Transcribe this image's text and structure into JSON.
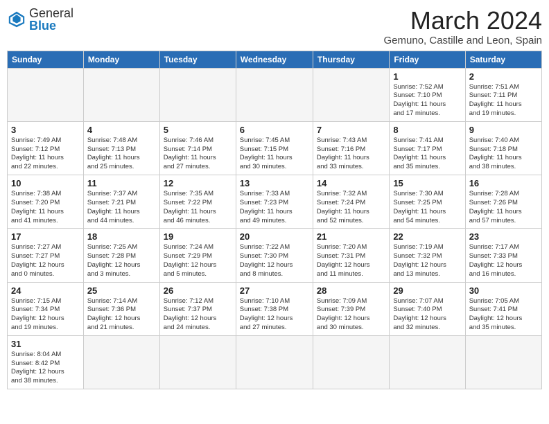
{
  "header": {
    "logo_general": "General",
    "logo_blue": "Blue",
    "month_title": "March 2024",
    "subtitle": "Gemuno, Castille and Leon, Spain"
  },
  "days_of_week": [
    "Sunday",
    "Monday",
    "Tuesday",
    "Wednesday",
    "Thursday",
    "Friday",
    "Saturday"
  ],
  "weeks": [
    [
      {
        "day": null,
        "info": null
      },
      {
        "day": null,
        "info": null
      },
      {
        "day": null,
        "info": null
      },
      {
        "day": null,
        "info": null
      },
      {
        "day": null,
        "info": null
      },
      {
        "day": "1",
        "info": "Sunrise: 7:52 AM\nSunset: 7:10 PM\nDaylight: 11 hours\nand 17 minutes."
      },
      {
        "day": "2",
        "info": "Sunrise: 7:51 AM\nSunset: 7:11 PM\nDaylight: 11 hours\nand 19 minutes."
      }
    ],
    [
      {
        "day": "3",
        "info": "Sunrise: 7:49 AM\nSunset: 7:12 PM\nDaylight: 11 hours\nand 22 minutes."
      },
      {
        "day": "4",
        "info": "Sunrise: 7:48 AM\nSunset: 7:13 PM\nDaylight: 11 hours\nand 25 minutes."
      },
      {
        "day": "5",
        "info": "Sunrise: 7:46 AM\nSunset: 7:14 PM\nDaylight: 11 hours\nand 27 minutes."
      },
      {
        "day": "6",
        "info": "Sunrise: 7:45 AM\nSunset: 7:15 PM\nDaylight: 11 hours\nand 30 minutes."
      },
      {
        "day": "7",
        "info": "Sunrise: 7:43 AM\nSunset: 7:16 PM\nDaylight: 11 hours\nand 33 minutes."
      },
      {
        "day": "8",
        "info": "Sunrise: 7:41 AM\nSunset: 7:17 PM\nDaylight: 11 hours\nand 35 minutes."
      },
      {
        "day": "9",
        "info": "Sunrise: 7:40 AM\nSunset: 7:18 PM\nDaylight: 11 hours\nand 38 minutes."
      }
    ],
    [
      {
        "day": "10",
        "info": "Sunrise: 7:38 AM\nSunset: 7:20 PM\nDaylight: 11 hours\nand 41 minutes."
      },
      {
        "day": "11",
        "info": "Sunrise: 7:37 AM\nSunset: 7:21 PM\nDaylight: 11 hours\nand 44 minutes."
      },
      {
        "day": "12",
        "info": "Sunrise: 7:35 AM\nSunset: 7:22 PM\nDaylight: 11 hours\nand 46 minutes."
      },
      {
        "day": "13",
        "info": "Sunrise: 7:33 AM\nSunset: 7:23 PM\nDaylight: 11 hours\nand 49 minutes."
      },
      {
        "day": "14",
        "info": "Sunrise: 7:32 AM\nSunset: 7:24 PM\nDaylight: 11 hours\nand 52 minutes."
      },
      {
        "day": "15",
        "info": "Sunrise: 7:30 AM\nSunset: 7:25 PM\nDaylight: 11 hours\nand 54 minutes."
      },
      {
        "day": "16",
        "info": "Sunrise: 7:28 AM\nSunset: 7:26 PM\nDaylight: 11 hours\nand 57 minutes."
      }
    ],
    [
      {
        "day": "17",
        "info": "Sunrise: 7:27 AM\nSunset: 7:27 PM\nDaylight: 12 hours\nand 0 minutes."
      },
      {
        "day": "18",
        "info": "Sunrise: 7:25 AM\nSunset: 7:28 PM\nDaylight: 12 hours\nand 3 minutes."
      },
      {
        "day": "19",
        "info": "Sunrise: 7:24 AM\nSunset: 7:29 PM\nDaylight: 12 hours\nand 5 minutes."
      },
      {
        "day": "20",
        "info": "Sunrise: 7:22 AM\nSunset: 7:30 PM\nDaylight: 12 hours\nand 8 minutes."
      },
      {
        "day": "21",
        "info": "Sunrise: 7:20 AM\nSunset: 7:31 PM\nDaylight: 12 hours\nand 11 minutes."
      },
      {
        "day": "22",
        "info": "Sunrise: 7:19 AM\nSunset: 7:32 PM\nDaylight: 12 hours\nand 13 minutes."
      },
      {
        "day": "23",
        "info": "Sunrise: 7:17 AM\nSunset: 7:33 PM\nDaylight: 12 hours\nand 16 minutes."
      }
    ],
    [
      {
        "day": "24",
        "info": "Sunrise: 7:15 AM\nSunset: 7:34 PM\nDaylight: 12 hours\nand 19 minutes."
      },
      {
        "day": "25",
        "info": "Sunrise: 7:14 AM\nSunset: 7:36 PM\nDaylight: 12 hours\nand 21 minutes."
      },
      {
        "day": "26",
        "info": "Sunrise: 7:12 AM\nSunset: 7:37 PM\nDaylight: 12 hours\nand 24 minutes."
      },
      {
        "day": "27",
        "info": "Sunrise: 7:10 AM\nSunset: 7:38 PM\nDaylight: 12 hours\nand 27 minutes."
      },
      {
        "day": "28",
        "info": "Sunrise: 7:09 AM\nSunset: 7:39 PM\nDaylight: 12 hours\nand 30 minutes."
      },
      {
        "day": "29",
        "info": "Sunrise: 7:07 AM\nSunset: 7:40 PM\nDaylight: 12 hours\nand 32 minutes."
      },
      {
        "day": "30",
        "info": "Sunrise: 7:05 AM\nSunset: 7:41 PM\nDaylight: 12 hours\nand 35 minutes."
      }
    ],
    [
      {
        "day": "31",
        "info": "Sunrise: 8:04 AM\nSunset: 8:42 PM\nDaylight: 12 hours\nand 38 minutes."
      },
      {
        "day": null,
        "info": null
      },
      {
        "day": null,
        "info": null
      },
      {
        "day": null,
        "info": null
      },
      {
        "day": null,
        "info": null
      },
      {
        "day": null,
        "info": null
      },
      {
        "day": null,
        "info": null
      }
    ]
  ]
}
